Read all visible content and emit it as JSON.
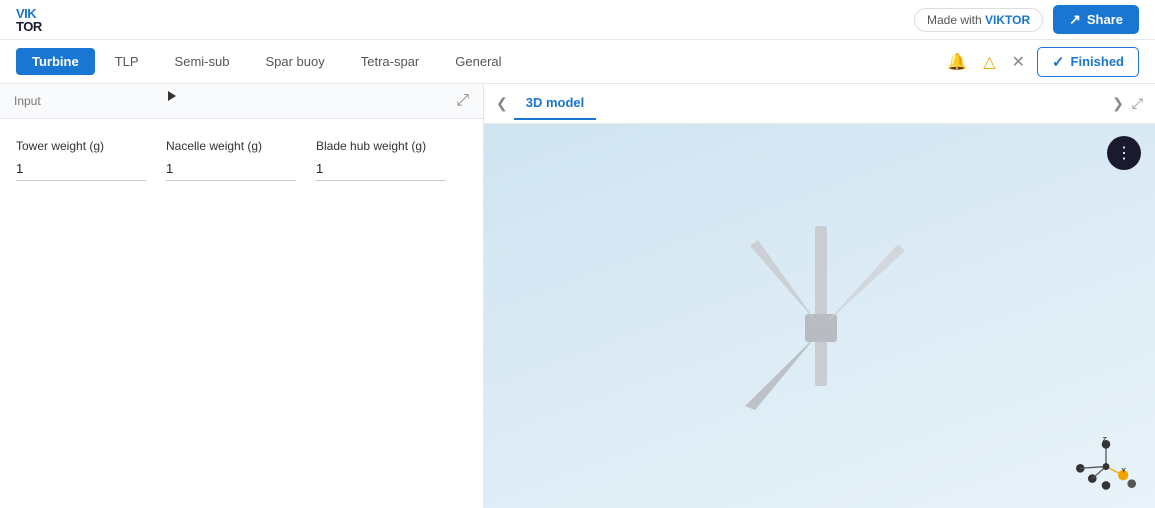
{
  "logo": {
    "line1": "VIK",
    "line2": "TOR"
  },
  "topbar": {
    "made_with_label": "Made with ",
    "made_with_brand": "VIKTOR",
    "share_label": "Share"
  },
  "nav": {
    "tabs": [
      {
        "id": "turbine",
        "label": "Turbine",
        "active": true
      },
      {
        "id": "tlp",
        "label": "TLP",
        "active": false
      },
      {
        "id": "semi-sub",
        "label": "Semi-sub",
        "active": false
      },
      {
        "id": "spar-buoy",
        "label": "Spar buoy",
        "active": false
      },
      {
        "id": "tetra-spar",
        "label": "Tetra-spar",
        "active": false
      },
      {
        "id": "general",
        "label": "General",
        "active": false
      }
    ],
    "finished_label": "Finished"
  },
  "left_panel": {
    "header_label": "Input",
    "fields": [
      {
        "label": "Tower weight (g)",
        "value": "1"
      },
      {
        "label": "Nacelle weight (g)",
        "value": "1"
      },
      {
        "label": "Blade hub weight (g)",
        "value": "1"
      }
    ]
  },
  "right_panel": {
    "tab_label": "3D model"
  }
}
